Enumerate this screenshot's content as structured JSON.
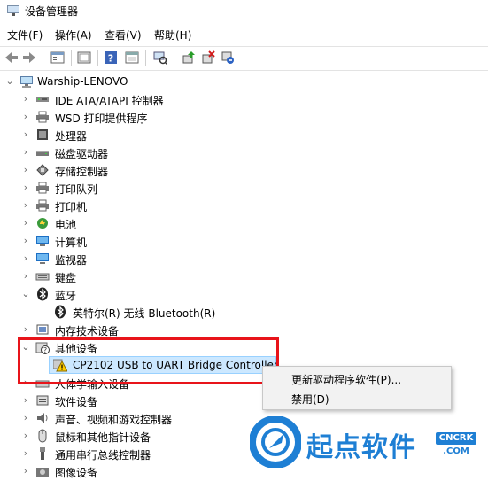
{
  "window": {
    "title": "设备管理器"
  },
  "menu": [
    "文件(F)",
    "操作(A)",
    "查看(V)",
    "帮助(H)"
  ],
  "toolbar": {
    "buttons": [
      "back-icon",
      "forward-icon",
      "properties-icon",
      "show-hide-icon",
      "help-icon",
      "view-icon",
      "scan-hardware-icon",
      "update-driver-icon",
      "uninstall-device-icon",
      "disable-device-icon"
    ]
  },
  "tree": {
    "root": "Warship-LENOVO",
    "items": [
      {
        "label": "IDE ATA/ATAPI 控制器",
        "icon": "ide-controller-icon",
        "expanded": false
      },
      {
        "label": "WSD 打印提供程序",
        "icon": "printer-icon",
        "expanded": false
      },
      {
        "label": "处理器",
        "icon": "processor-icon",
        "expanded": false
      },
      {
        "label": "磁盘驱动器",
        "icon": "disk-drive-icon",
        "expanded": false
      },
      {
        "label": "存储控制器",
        "icon": "storage-controller-icon",
        "expanded": false
      },
      {
        "label": "打印队列",
        "icon": "print-queue-icon",
        "expanded": false
      },
      {
        "label": "打印机",
        "icon": "printer-icon",
        "expanded": false
      },
      {
        "label": "电池",
        "icon": "battery-icon",
        "expanded": false
      },
      {
        "label": "计算机",
        "icon": "computer-icon",
        "expanded": false
      },
      {
        "label": "监视器",
        "icon": "monitor-icon",
        "expanded": false
      },
      {
        "label": "键盘",
        "icon": "keyboard-icon",
        "expanded": false
      },
      {
        "label": "蓝牙",
        "icon": "bluetooth-icon",
        "expanded": true
      },
      {
        "label": "英特尔(R) 无线 Bluetooth(R)",
        "icon": "bluetooth-icon",
        "child": true
      },
      {
        "label": "内存技术设备",
        "icon": "memory-device-icon",
        "expanded": false
      },
      {
        "label": "其他设备",
        "icon": "unknown-device-icon",
        "expanded": true
      },
      {
        "label": "CP2102 USB to UART Bridge Controller",
        "icon": "warning-icon",
        "child": true,
        "selected": true
      },
      {
        "label": "人体学输入设备",
        "icon": "hid-icon",
        "expanded": false
      },
      {
        "label": "软件设备",
        "icon": "software-device-icon",
        "expanded": false
      },
      {
        "label": "声音、视频和游戏控制器",
        "icon": "sound-icon",
        "expanded": false
      },
      {
        "label": "鼠标和其他指针设备",
        "icon": "mouse-icon",
        "expanded": false
      },
      {
        "label": "通用串行总线控制器",
        "icon": "usb-icon",
        "expanded": false
      },
      {
        "label": "图像设备",
        "icon": "camera-icon",
        "expanded": false
      }
    ]
  },
  "context_menu": {
    "items": [
      "更新驱动程序软件(P)...",
      "禁用(D)"
    ]
  },
  "watermark": {
    "brand": "起点软件",
    "badge": "CNCRK",
    "domain": ".COM"
  },
  "colors": {
    "selection_bg": "#cce8ff",
    "highlight_border": "#e8141a",
    "watermark_blue": "#1e7fd4"
  }
}
